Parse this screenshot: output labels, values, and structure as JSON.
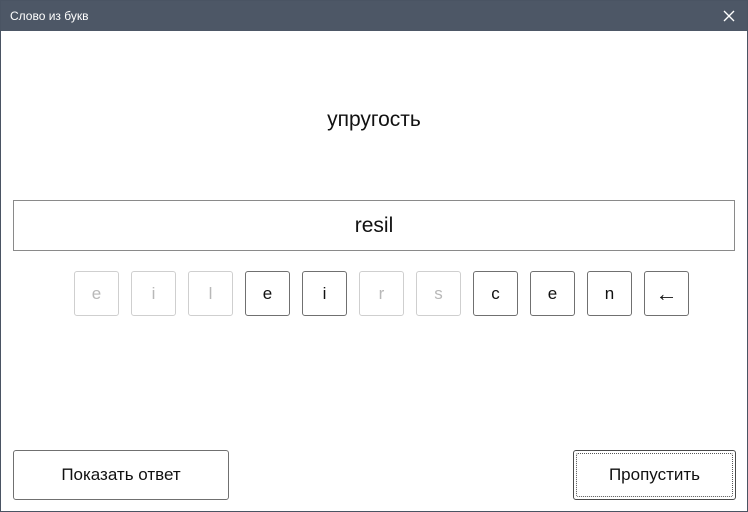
{
  "window": {
    "title": "Слово из букв",
    "close_icon": "close-icon"
  },
  "task": {
    "prompt_word": "упругость",
    "answer_value": "resil"
  },
  "letters": [
    {
      "char": "e",
      "used": true
    },
    {
      "char": "i",
      "used": true
    },
    {
      "char": "l",
      "used": true
    },
    {
      "char": "e",
      "used": false
    },
    {
      "char": "i",
      "used": false
    },
    {
      "char": "r",
      "used": true
    },
    {
      "char": "s",
      "used": true
    },
    {
      "char": "c",
      "used": false
    },
    {
      "char": "e",
      "used": false
    },
    {
      "char": "n",
      "used": false
    }
  ],
  "backspace_label": "←",
  "buttons": {
    "show_answer_label": "Показать ответ",
    "skip_label": "Пропустить"
  },
  "colors": {
    "titlebar": "#4d5766",
    "key_disabled_text": "#b8b8b8",
    "key_border": "#707070"
  }
}
